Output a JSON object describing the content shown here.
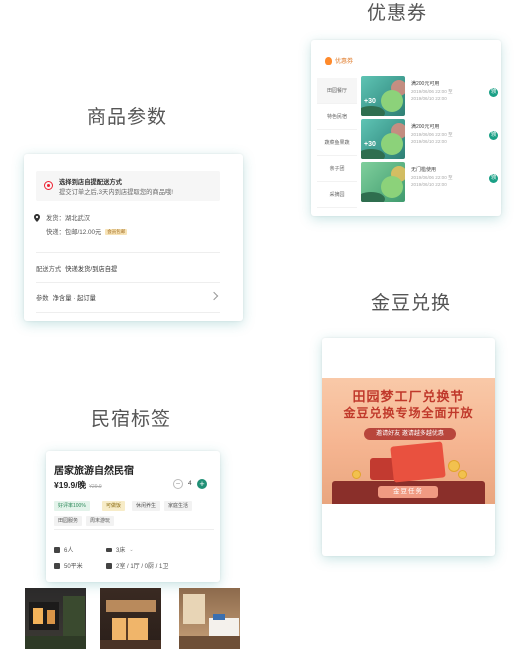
{
  "sections": {
    "coupons": "优惠券",
    "product_params": "商品参数",
    "gold_bean": "金豆兑换",
    "homestay": "民宿标签"
  },
  "coupons": {
    "header": "优惠券",
    "categories": [
      "田园餐厅",
      "特色民宿",
      "蔬菜鱼果蔬",
      "亲子团",
      "采摘园"
    ],
    "items": [
      {
        "amount": "+30",
        "title": "满200元可用",
        "date1": "2019/06/06 22:00 至",
        "date2": "2019/06/10 22:00",
        "button": "领"
      },
      {
        "amount": "+30",
        "title": "满200元可用",
        "date1": "2019/06/06 22:00 至",
        "date2": "2019/06/10 22:00",
        "button": "领"
      },
      {
        "amount": "",
        "title": "无门槛使用",
        "date1": "2019/06/06 22:00 至",
        "date2": "2019/06/10 22:00",
        "button": "领"
      }
    ],
    "accent": "#1aa086"
  },
  "product_params": {
    "banner_title": "选择到店自提配送方式",
    "banner_sub": "提交订单之后,3天内到店提取您的商品哦!",
    "ship_from": "发货：湖北武汉",
    "express": "快递：包邮/12.00元",
    "express_tag": "会员包邮",
    "delivery_label": "配送方式",
    "delivery_value": "快递发货/到店自提",
    "params_label": "参数",
    "params_value": "净含量 · 起订量"
  },
  "gold_bean": {
    "title_line1": "田园梦工厂兑换节",
    "title_line2": "金豆兑换专场全面开放",
    "pill": "邀请好友 邀请越多越优惠",
    "button": "金豆任务"
  },
  "homestay": {
    "title": "居家旅游自然民宿",
    "price": "¥19.9/晚",
    "old_price": "¥29.9",
    "quantity": "4",
    "tags": [
      "好评率100%",
      "可做饭",
      "休闲养生",
      "家庭生活",
      "田园服务",
      "周末游玩"
    ],
    "info": {
      "guests": "6人",
      "beds": "3床",
      "area": "50平米",
      "rooms": "2室 / 1厅 / 0厨 / 1卫"
    },
    "accent": "#1f8f75"
  }
}
